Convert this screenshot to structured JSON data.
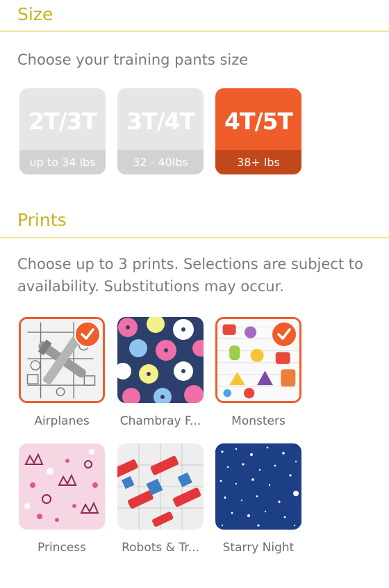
{
  "size": {
    "title": "Size",
    "description": "Choose your training pants size",
    "options": [
      {
        "label": "2T/3T",
        "range": "up to 34 lbs",
        "selected": false
      },
      {
        "label": "3T/4T",
        "range": "32 - 40lbs",
        "selected": false
      },
      {
        "label": "4T/5T",
        "range": "38+ lbs",
        "selected": true
      }
    ]
  },
  "prints": {
    "title": "Prints",
    "description": "Choose up to 3 prints. Selections are subject to availability. Substitutions may occur.",
    "items": [
      {
        "label": "Airplanes",
        "selected": true
      },
      {
        "label": "Chambray F...",
        "selected": false
      },
      {
        "label": "Monsters",
        "selected": true
      },
      {
        "label": "Princess",
        "selected": false
      },
      {
        "label": "Robots & Tr...",
        "selected": false
      },
      {
        "label": "Starry Night",
        "selected": false
      }
    ]
  },
  "colors": {
    "accent": "#ee5d2a",
    "heading": "#c9b21e",
    "rule": "#efe39a",
    "tile_gray": "#e6e6e6"
  },
  "icons": {
    "selected_mark": "checkmark-icon"
  }
}
